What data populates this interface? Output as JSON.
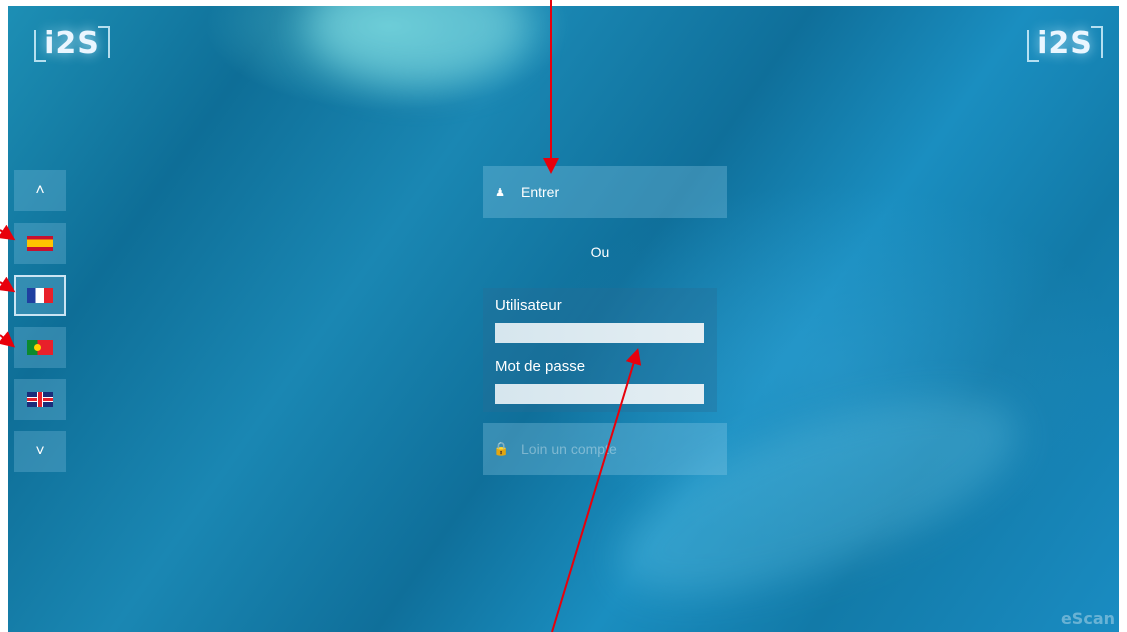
{
  "header": {
    "logo_left_text": "i2S",
    "logo_right_text": "i2S"
  },
  "language_sidebar": {
    "scroll_up_icon": "chevron-up-icon",
    "scroll_down_icon": "chevron-down-icon",
    "flags": [
      {
        "icon": "spain-flag-icon",
        "selected": false
      },
      {
        "icon": "france-flag-icon",
        "selected": true
      },
      {
        "icon": "portugal-flag-icon",
        "selected": false
      },
      {
        "icon": "uk-flag-icon",
        "selected": false
      }
    ]
  },
  "login": {
    "enter_button_label": "Entrer",
    "enter_icon": "users-icon",
    "or_label": "Ou",
    "username_label": "Utilisateur",
    "username_value": "",
    "password_label": "Mot de passe",
    "password_value": "",
    "account_button_label": "Loin un compte",
    "account_icon": "lock-icon"
  },
  "footer": {
    "watermark": "eScan"
  },
  "colors": {
    "annotation_arrow": "#e8000b",
    "panel_button": "#8ccbe6"
  }
}
